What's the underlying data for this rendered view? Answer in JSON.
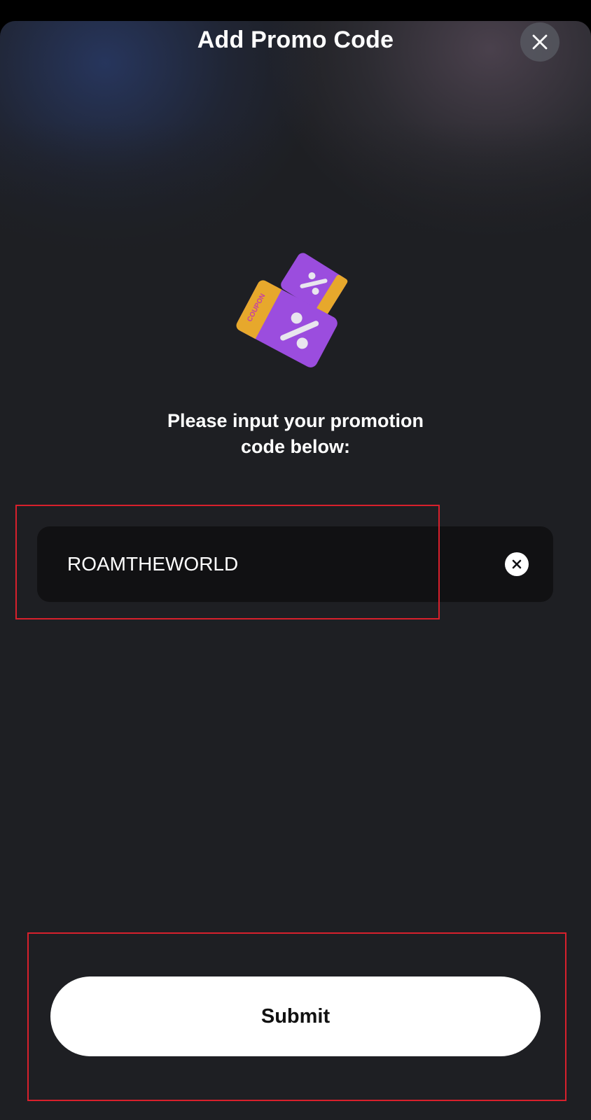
{
  "modal": {
    "title": "Add Promo Code",
    "close_icon": "close-icon"
  },
  "illustration": {
    "icon": "coupon-icon",
    "coupon_label": "COUPON",
    "colors": {
      "ticket_purple": "#9b4dde",
      "ticket_orange": "#e7a82c",
      "percent_sign": "#e8e6ee"
    }
  },
  "instructions": {
    "line1": "Please input your promotion",
    "line2": "code below:"
  },
  "promo_input": {
    "value": "ROAMTHEWORLD",
    "clear_icon": "clear-icon"
  },
  "submit": {
    "label": "Submit"
  },
  "colors": {
    "background": "#1e1f23",
    "field_background": "#111113",
    "button_background": "#ffffff",
    "highlight_outline": "#d8202c"
  }
}
